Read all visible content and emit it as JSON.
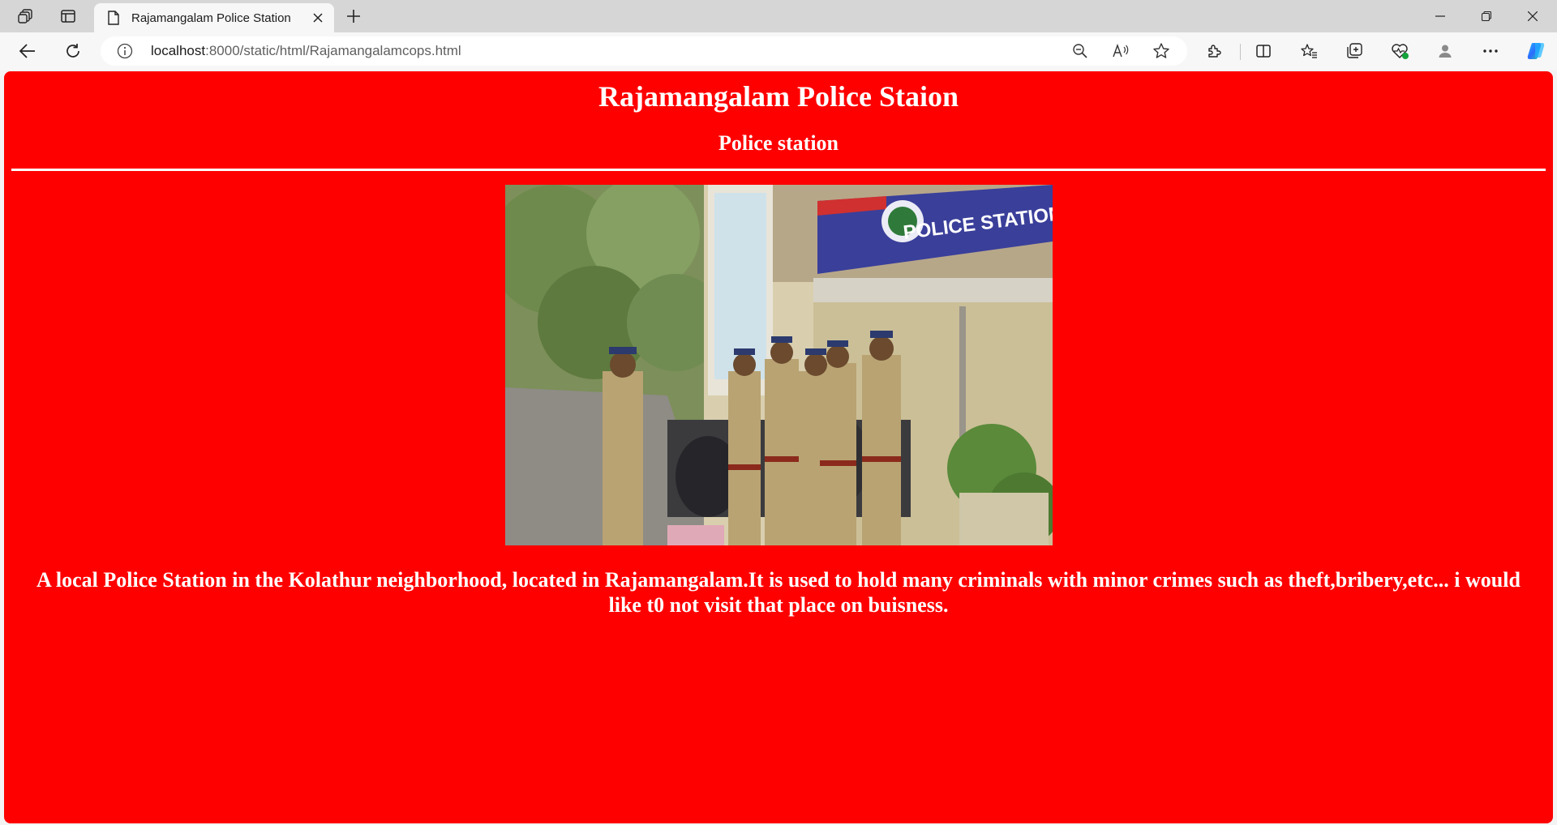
{
  "browser": {
    "tab": {
      "title": "Rajamangalam Police Station"
    },
    "address": {
      "host": "localhost",
      "rest": ":8000/static/html/Rajamangalamcops.html"
    }
  },
  "page": {
    "heading": "Rajamangalam Police Staion",
    "subheading": "Police station",
    "image": {
      "sign_text": "POLICE STATION"
    },
    "description": "A local Police Station in the Kolathur neighborhood, located in Rajamangalam.It is used to hold many criminals with minor crimes such as theft,bribery,etc... i would like t0 not visit that place on buisness."
  },
  "colors": {
    "page_background": "#ff0000",
    "text": "#ffffff"
  }
}
